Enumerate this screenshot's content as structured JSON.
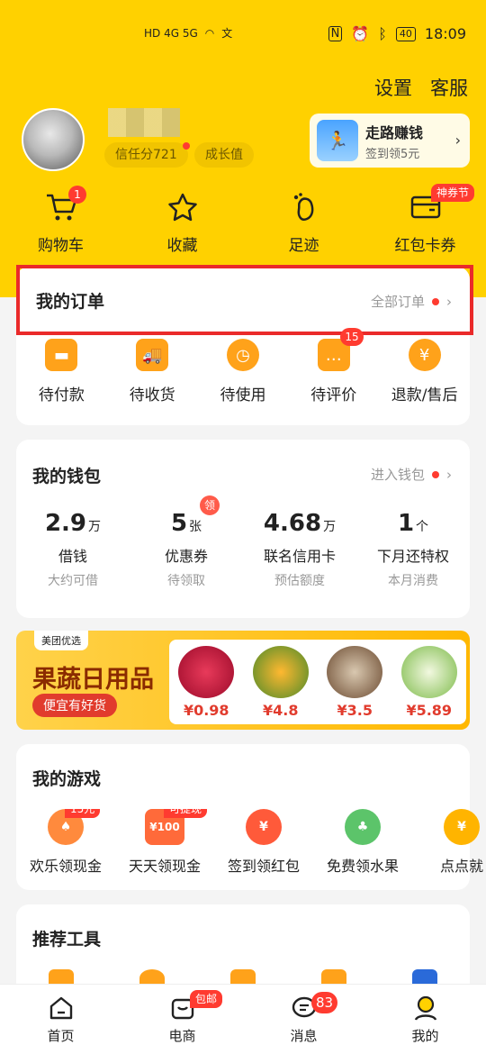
{
  "status_bar": {
    "time": "18:09",
    "battery": "40",
    "network": "HD 4G 5G",
    "input": "文"
  },
  "header": {
    "settings": "设置",
    "service": "客服"
  },
  "profile": {
    "credit_chip": "信任分721",
    "growth_chip": "成长值"
  },
  "walk_card": {
    "title": "走路赚钱",
    "subtitle": "签到领5元"
  },
  "quick_actions": [
    {
      "label": "购物车",
      "icon": "cart-icon",
      "badge": "1"
    },
    {
      "label": "收藏",
      "icon": "star-icon"
    },
    {
      "label": "足迹",
      "icon": "footprint-icon"
    },
    {
      "label": "红包卡券",
      "icon": "coupon-icon",
      "tag": "神券节"
    }
  ],
  "orders": {
    "title": "我的订单",
    "more": "全部订单",
    "items": [
      {
        "label": "待付款",
        "icon": "wallet-icon"
      },
      {
        "label": "待收货",
        "icon": "truck-icon"
      },
      {
        "label": "待使用",
        "icon": "clock-icon"
      },
      {
        "label": "待评价",
        "icon": "comment-icon",
        "badge": "15"
      },
      {
        "label": "退款/售后",
        "icon": "refund-icon"
      }
    ]
  },
  "wallet": {
    "title": "我的钱包",
    "more": "进入钱包",
    "items": [
      {
        "value": "2.9",
        "unit": "万",
        "label": "借钱",
        "sub": "大约可借"
      },
      {
        "value": "5",
        "unit": "张",
        "label": "优惠券",
        "sub": "待领取",
        "badge": "领"
      },
      {
        "value": "4.68",
        "unit": "万",
        "label": "联名信用卡",
        "sub": "预估额度"
      },
      {
        "value": "1",
        "unit": "个",
        "label": "下月还特权",
        "sub": "本月消费"
      }
    ]
  },
  "promo": {
    "logo": "美团优选",
    "title": "果蔬日用品",
    "button": "便宜有好货",
    "products": [
      {
        "price": "¥0.98",
        "color": "#c8102e"
      },
      {
        "price": "¥4.8",
        "color": "#f29a1a"
      },
      {
        "price": "¥3.5",
        "color": "#8a6a4a"
      },
      {
        "price": "¥5.89",
        "color": "#7dbb4a"
      }
    ]
  },
  "games": {
    "title": "我的游戏",
    "items": [
      {
        "label": "欢乐领现金",
        "badge": "15元",
        "color": "#ff8a3d"
      },
      {
        "label": "天天领现金",
        "badge": "可提现",
        "color": "#ff6a3a",
        "icon_text": "¥100"
      },
      {
        "label": "签到领红包",
        "color": "#ff5a3a"
      },
      {
        "label": "免费领水果",
        "color": "#5cc46a"
      },
      {
        "label": "点点就",
        "color": "#ffb400"
      }
    ]
  },
  "tools": {
    "title": "推荐工具"
  },
  "nav": [
    {
      "label": "首页",
      "icon": "home-icon"
    },
    {
      "label": "电商",
      "icon": "shop-icon",
      "tag": "包邮"
    },
    {
      "label": "消息",
      "icon": "message-icon",
      "badge": "83"
    },
    {
      "label": "我的",
      "icon": "profile-icon"
    }
  ]
}
